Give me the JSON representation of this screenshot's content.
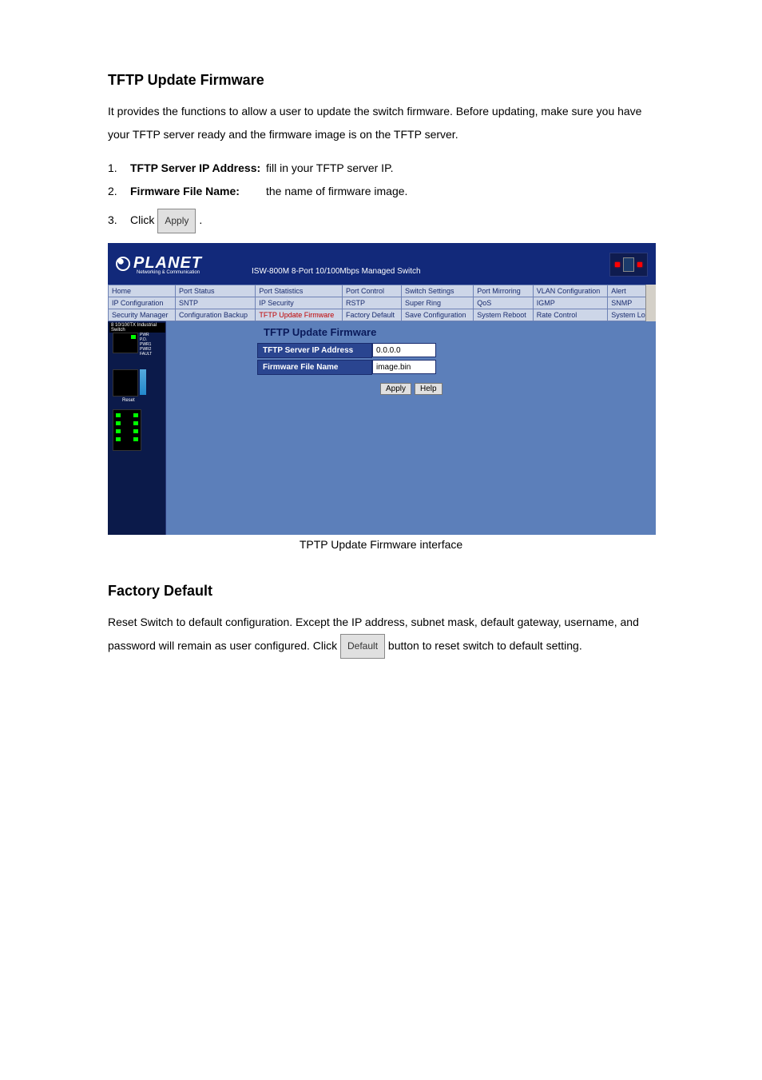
{
  "section1": {
    "heading": "TFTP Update Firmware",
    "intro": "It provides the functions to allow a user to update the switch firmware. Before updating, make sure you have your TFTP server ready and the firmware image is on the TFTP server.",
    "steps": [
      {
        "num": "1.",
        "label": "TFTP Server IP Address:",
        "text": "fill in your TFTP server IP."
      },
      {
        "num": "2.",
        "label": "Firmware File Name:",
        "text": "the name of firmware image."
      }
    ],
    "step3_num": "3.",
    "step3_pre": "Click ",
    "step3_btn": "Apply",
    "step3_post": "."
  },
  "screenshot": {
    "brand": "PLANET",
    "brand_sub": "Networking & Communication",
    "model": "ISW-800M 8-Port 10/100Mbps Managed Switch",
    "nav": {
      "row1": [
        "Home",
        "Port Status",
        "Port Statistics",
        "Port Control",
        "Switch Settings",
        "Port Mirroring",
        "VLAN Configuration",
        "Alert"
      ],
      "row2": [
        "IP Configuration",
        "SNTP",
        "IP Security",
        "RSTP",
        "Super Ring",
        "QoS",
        "IGMP",
        "SNMP"
      ],
      "row3": [
        "Security Manager",
        "Configuration Backup",
        "TFTP Update Firmware",
        "Factory Default",
        "Save Configuration",
        "System Reboot",
        "Rate Control",
        "System Log"
      ],
      "active": "TFTP Update Firmware"
    },
    "side_title": "8 10/100TX Industrial Switch",
    "panel_title": "TFTP Update Firmware",
    "form": {
      "ip_label": "TFTP Server IP Address",
      "ip_value": "0.0.0.0",
      "file_label": "Firmware File Name",
      "file_value": "image.bin"
    },
    "buttons": {
      "apply": "Apply",
      "help": "Help"
    }
  },
  "caption1": "TPTP Update Firmware interface",
  "section2": {
    "heading": "Factory Default",
    "text_pre": "Reset Switch to default configuration. Except the IP address, subnet mask, default gateway, username, and password will remain as user configured. Click ",
    "btn": "Default",
    "text_post": " button to reset switch to default setting."
  }
}
